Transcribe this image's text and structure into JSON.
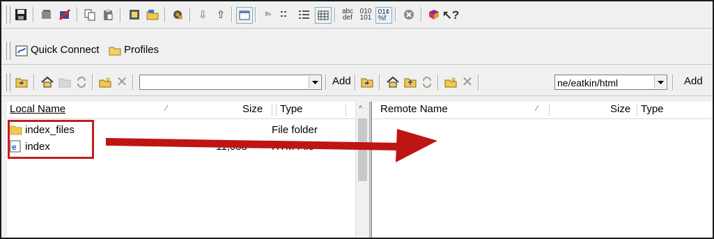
{
  "toolbar3": {
    "add_label": "Add"
  },
  "toolbar2": {
    "quick_connect_label": "Quick Connect",
    "profiles_label": "Profiles"
  },
  "local_pane": {
    "combo_value": "",
    "add_label": "Add",
    "columns": [
      "Local Name",
      "Size",
      "Type"
    ],
    "rows": [
      {
        "name": "index_files",
        "size": "",
        "type": "File folder"
      },
      {
        "name": "index",
        "size": "11,033",
        "type": "HTM File"
      }
    ]
  },
  "remote_pane": {
    "path_value": "ne/eatkin/html",
    "add_label": "Add",
    "columns": [
      "Remote Name",
      "Size",
      "Type"
    ]
  },
  "annotation": {
    "highlight_color": "#c41e1e",
    "arrow_color": "#bf1414"
  }
}
